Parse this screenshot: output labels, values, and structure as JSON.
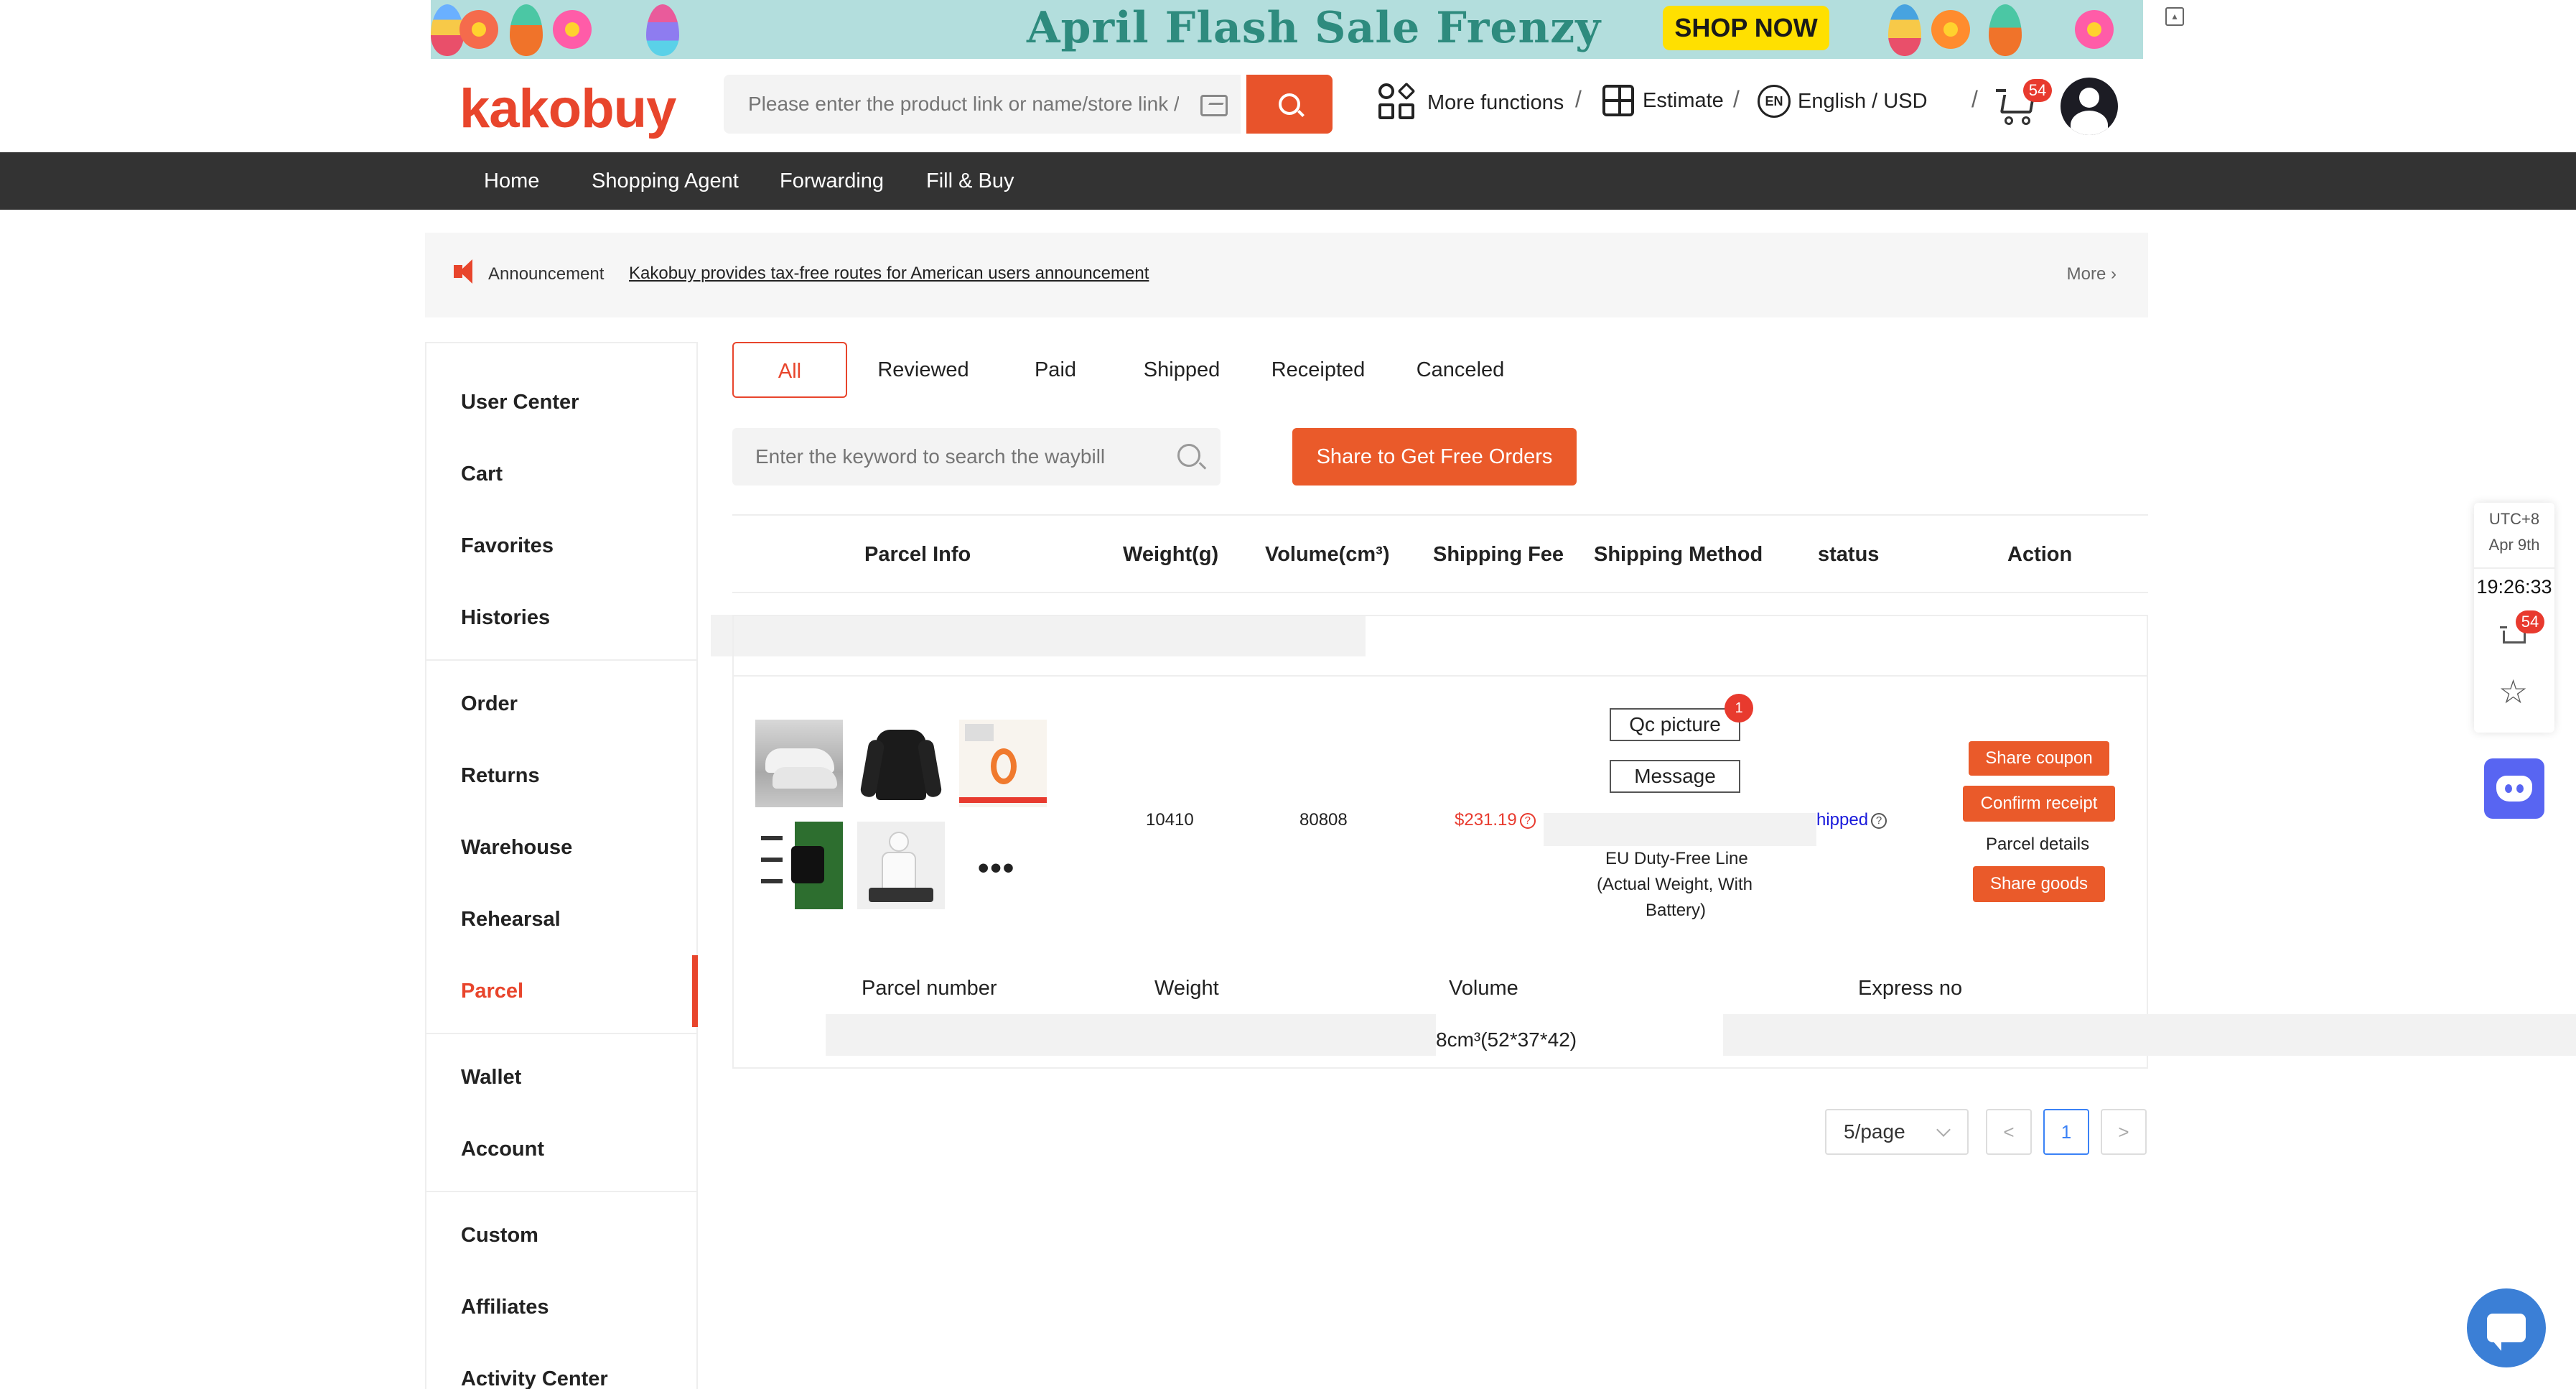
{
  "banner": {
    "title": "April Flash Sale Frenzy",
    "cta": "SHOP NOW"
  },
  "header": {
    "logo": "kakobuy",
    "search_placeholder": "Please enter the product link or name/store link /F",
    "more_functions": "More functions",
    "estimate": "Estimate",
    "language_currency": "English / USD",
    "language_icon_text": "EN",
    "cart_count": "54",
    "sep": "/"
  },
  "nav": [
    "Home",
    "Shopping Agent",
    "Forwarding",
    "Fill & Buy"
  ],
  "announcement": {
    "label": "Announcement",
    "text": "Kakobuy provides tax-free routes for American users announcement",
    "more": "More"
  },
  "sidebar": {
    "items": [
      "User Center",
      "Cart",
      "Favorites",
      "Histories",
      "Order",
      "Returns",
      "Warehouse",
      "Rehearsal",
      "Parcel",
      "Wallet",
      "Account",
      "Custom",
      "Affiliates",
      "Activity Center"
    ],
    "active": "Parcel"
  },
  "tabs": [
    "All",
    "Reviewed",
    "Paid",
    "Shipped",
    "Receipted",
    "Canceled"
  ],
  "waybill_search": {
    "placeholder": "Enter the keyword to search the waybill"
  },
  "share_free_orders": "Share to Get Free Orders",
  "table": {
    "headers": [
      "Parcel Info",
      "Weight(g)",
      "Volume(cm³)",
      "Shipping Fee",
      "Shipping Method",
      "status",
      "Action"
    ],
    "row": {
      "weight": "10410",
      "volume": "80808",
      "shipping_fee": "$231.19",
      "qc_picture": "Qc picture",
      "qc_badge": "1",
      "message": "Message",
      "shipping_method_line1": "EU Duty-Free Line",
      "shipping_method_line2": "(Actual Weight, With",
      "shipping_method_line3": "Battery)",
      "status": "hipped",
      "more_thumbs": "•••",
      "actions": {
        "share_coupon": "Share coupon",
        "confirm_receipt": "Confirm receipt",
        "parcel_details": "Parcel details",
        "share_goods": "Share goods"
      }
    },
    "sub_headers": [
      "Parcel number",
      "Weight",
      "Volume",
      "Express no"
    ],
    "sub_volume": "8cm³(52*37*42)"
  },
  "pagination": {
    "page_size": "5/page",
    "current_page": "1",
    "prev": "<",
    "next": ">"
  },
  "widget": {
    "tz": "UTC+8",
    "date": "Apr 9th",
    "time": "19:26:33",
    "cart_count": "54",
    "star": "☆"
  },
  "colors": {
    "accent": "#e8452c",
    "button": "#ea5a2a",
    "nav_bg": "#333333",
    "link_blue": "#3b82f6"
  }
}
